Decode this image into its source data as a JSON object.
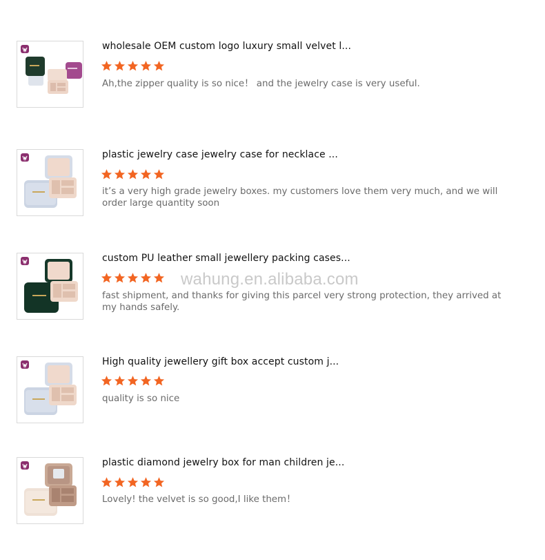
{
  "brand": {
    "star_color": "#f26522",
    "badge_color": "#8b2f6e"
  },
  "watermark": "wahung.en.alibaba.com",
  "reviews": [
    {
      "product_title": "wholesale OEM custom logo luxury small velvet l...",
      "rating": 5,
      "comment": "Ah,the zipper quality is so nice！ and the jewelry case is very useful."
    },
    {
      "product_title": "plastic jewelry case jewelry case for necklace ...",
      "rating": 5,
      "comment": "it’s a very high grade jewelry boxes. my customers love them very much, and we will order large quantity soon"
    },
    {
      "product_title": "custom PU leather small jewellery packing cases...",
      "rating": 5,
      "comment": "fast shipment, and thanks for giving this parcel very strong protection, they arrived at my hands safely."
    },
    {
      "product_title": "High quality jewellery gift box accept custom j...",
      "rating": 5,
      "comment": "quality is so nice"
    },
    {
      "product_title": "plastic diamond jewelry box for man children je...",
      "rating": 5,
      "comment": "Lovely! the velvet is so good,I like them！"
    }
  ]
}
